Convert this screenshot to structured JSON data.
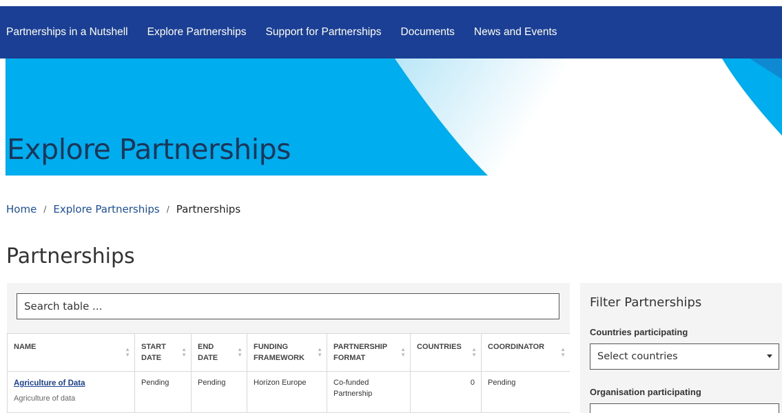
{
  "nav": {
    "items": [
      {
        "label": "Partnerships in a Nutshell"
      },
      {
        "label": "Explore Partnerships"
      },
      {
        "label": "Support for Partnerships"
      },
      {
        "label": "Documents"
      },
      {
        "label": "News and Events"
      }
    ]
  },
  "banner": {
    "title": "Explore Partnerships"
  },
  "breadcrumb": {
    "home": "Home",
    "separator": "/",
    "parent": "Explore Partnerships",
    "current": "Partnerships"
  },
  "page": {
    "title": "Partnerships"
  },
  "table": {
    "search_placeholder": "Search table ...",
    "columns": [
      {
        "label": "NAME"
      },
      {
        "label": "START DATE"
      },
      {
        "label": "END DATE"
      },
      {
        "label": "FUNDING FRAMEWORK"
      },
      {
        "label": "PARTNERSHIP FORMAT"
      },
      {
        "label": "COUNTRIES"
      },
      {
        "label": "COORDINATOR"
      }
    ],
    "rows": [
      {
        "name": "Agriculture of Data",
        "description": "Agriculture of data",
        "start_date": "Pending",
        "end_date": "Pending",
        "funding_framework": "Horizon Europe",
        "format": "Co-funded Partnership",
        "countries": "0",
        "coordinator": "Pending"
      }
    ]
  },
  "filter": {
    "title": "Filter Partnerships",
    "countries_label": "Countries participating",
    "countries_placeholder": "Select countries",
    "org_label": "Organisation participating"
  },
  "colors": {
    "nav_bg": "#1a3f94",
    "banner_bg": "#00aeef",
    "link": "#1a4fa0",
    "panel_bg": "#f4f4f4"
  }
}
